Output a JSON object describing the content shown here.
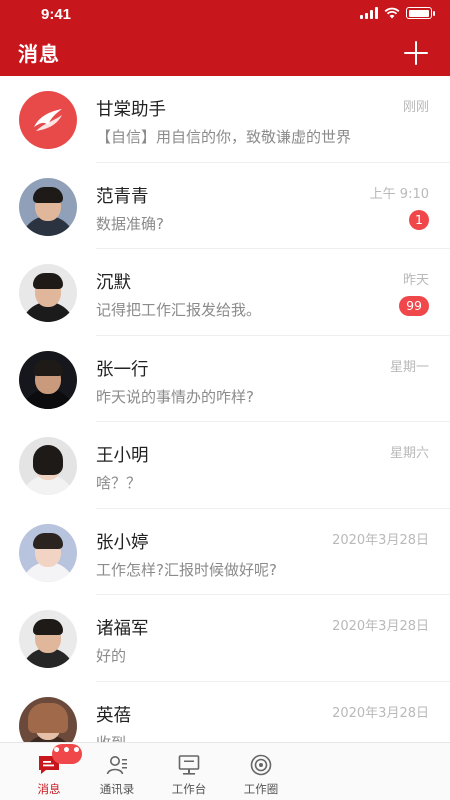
{
  "status_bar": {
    "time": "9:41"
  },
  "header": {
    "title": "消息"
  },
  "conversations": [
    {
      "name": "甘棠助手",
      "message": "【自信】用自信的你，致敬谦虚的世界",
      "time": "刚刚",
      "badge": ""
    },
    {
      "name": "范青青",
      "message": "数据准确?",
      "time": "上午 9:10",
      "badge": "1"
    },
    {
      "name": "沉默",
      "message": "记得把工作汇报发给我。",
      "time": "昨天",
      "badge": "99"
    },
    {
      "name": "张一行",
      "message": "昨天说的事情办的咋样?",
      "time": "星期一",
      "badge": ""
    },
    {
      "name": "王小明",
      "message": "啥？？",
      "time": "星期六",
      "badge": ""
    },
    {
      "name": "张小婷",
      "message": "工作怎样?汇报时候做好呢?",
      "time": "2020年3月28日",
      "badge": ""
    },
    {
      "name": "诸福军",
      "message": "好的",
      "time": "2020年3月28日",
      "badge": ""
    },
    {
      "name": "英蓓",
      "message": "收到",
      "time": "2020年3月28日",
      "badge": ""
    }
  ],
  "tabbar": {
    "badge": "•••",
    "tabs": [
      {
        "label": "消息",
        "icon": "message-icon"
      },
      {
        "label": "通讯录",
        "icon": "contacts-icon"
      },
      {
        "label": "工作台",
        "icon": "workbench-icon"
      },
      {
        "label": "工作圈",
        "icon": "work-circle-icon"
      }
    ]
  },
  "colors": {
    "brand": "#c8161d",
    "badge": "#f0474a"
  }
}
